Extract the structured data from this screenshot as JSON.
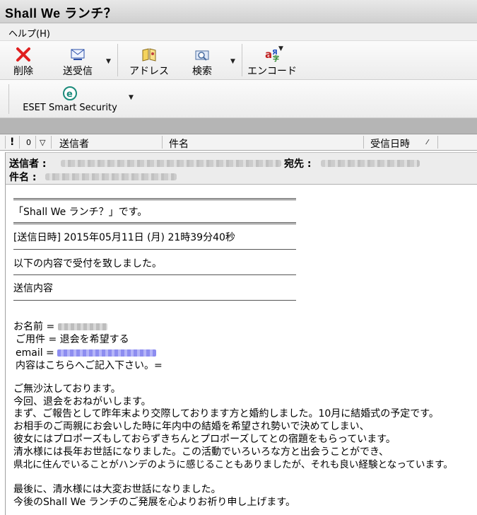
{
  "window": {
    "title": "Shall We ランチ？"
  },
  "menu": {
    "help": "ヘルプ(H)"
  },
  "toolbar": {
    "delete": "削除",
    "send_receive": "送受信",
    "address": "アドレス",
    "search": "検索",
    "encode": "エンコード",
    "eset": "ESET Smart Security"
  },
  "list_header": {
    "flag": "!",
    "attach": "0",
    "mark": "▽",
    "from": "送信者",
    "subject": "件名",
    "date": "受信日時"
  },
  "message_header": {
    "from_label": "送信者",
    "to_label": "宛先",
    "subject_label": "件名"
  },
  "body": {
    "rule1": "====================================",
    "shall_we": "「Shall We ランチ？」です。",
    "rule2": "====================================",
    "sent_datetime": "[送信日時] 2015年05月11日 (月) 21時39分40秒",
    "accept": "以下の内容で受付を致しました。",
    "content_title": "送信内容",
    "name": "お名前 =",
    "purpose": "ご用件 = 退会を希望する",
    "email": "email =",
    "content": "内容はこちらへご記入下さい。=",
    "p1": "ご無沙汰しております。",
    "p2": "今回、退会をおねがいします。",
    "p3": "まず、ご報告として昨年末より交際しております方と婚約しました。10月に結婚式の予定です。",
    "p4": "お相手のご両親にお会いした時に年内中の結婚を希望され勢いで決めてしまい、",
    "p5": "彼女にはプロポーズもしておらずきちんとプロポーズしてとの宿題をもらっています。",
    "p6": "清水様には長年お世話になりました。この活動でいろいろな方と出会うことができ、",
    "p7": "県北に住んでいることがハンデのように感じることもありましたが、それも良い経験となっています。",
    "p8": "最後に、清水様には大変お世話になりました。",
    "p9": "今後のShall We ランチのご発展を心よりお祈り申し上げます。"
  },
  "colors": {
    "accent": "#e02020",
    "blue_link": "#5a5ae8"
  }
}
